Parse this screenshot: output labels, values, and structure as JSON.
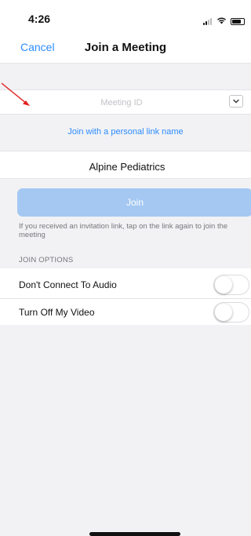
{
  "status_bar": {
    "time": "4:26"
  },
  "nav": {
    "cancel_label": "Cancel",
    "title": "Join a Meeting"
  },
  "meeting_id": {
    "placeholder": "Meeting ID",
    "value": ""
  },
  "personal_link_label": "Join with a personal link name",
  "display_name": {
    "value": "Alpine Pediatrics"
  },
  "join": {
    "label": "Join",
    "enabled": false,
    "help_text": "If you received an invitation link, tap on the link again to join the meeting"
  },
  "join_options": {
    "header": "JOIN OPTIONS",
    "items": [
      {
        "label": "Don't Connect To Audio",
        "enabled": false
      },
      {
        "label": "Turn Off My Video",
        "enabled": false
      }
    ]
  },
  "colors": {
    "accent": "#2d8cff",
    "join_disabled": "#a4c8f2",
    "group_background": "#f2f2f4",
    "annotation_arrow": "#e02020"
  },
  "icons": {
    "dropdown": "chevron-down-icon",
    "signal": "cellular-signal-icon",
    "wifi": "wifi-icon",
    "battery": "battery-icon"
  }
}
